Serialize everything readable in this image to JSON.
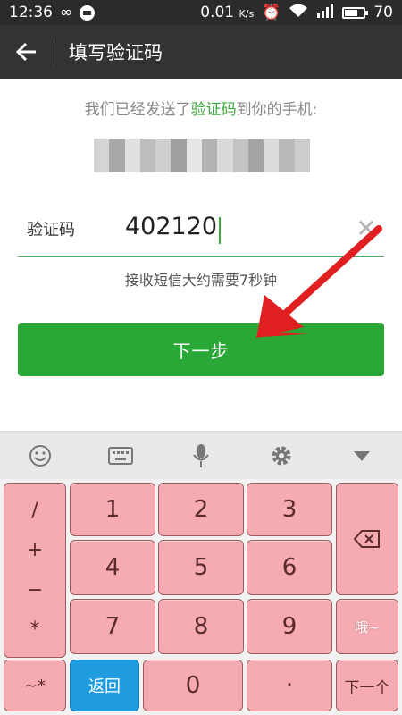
{
  "status_bar": {
    "time": "12:36",
    "speed": "0.01",
    "speed_unit": "K/s",
    "battery": "70",
    "battery_level": 0.7
  },
  "titlebar": {
    "title": "填写验证码"
  },
  "info": {
    "prefix": "我们已经发送了",
    "highlight": "验证码",
    "suffix": "到你的手机:"
  },
  "code": {
    "label": "验证码",
    "value": "402120"
  },
  "hint": "接收短信大约需要7秒钟",
  "next_button": "下一步",
  "keyboard": {
    "symbols": [
      "/",
      "+",
      "−",
      "*"
    ],
    "digits": [
      "1",
      "2",
      "3",
      "4",
      "5",
      "6",
      "7",
      "8",
      "9",
      "0"
    ],
    "tilde": "~*",
    "return": "返回",
    "dot": "·",
    "next": "下一个",
    "face": "哦~"
  },
  "colors": {
    "accent_green": "#2aa837",
    "key_pink": "#f6aab1",
    "return_blue": "#1f9be0",
    "arrow_red": "#e02020"
  }
}
